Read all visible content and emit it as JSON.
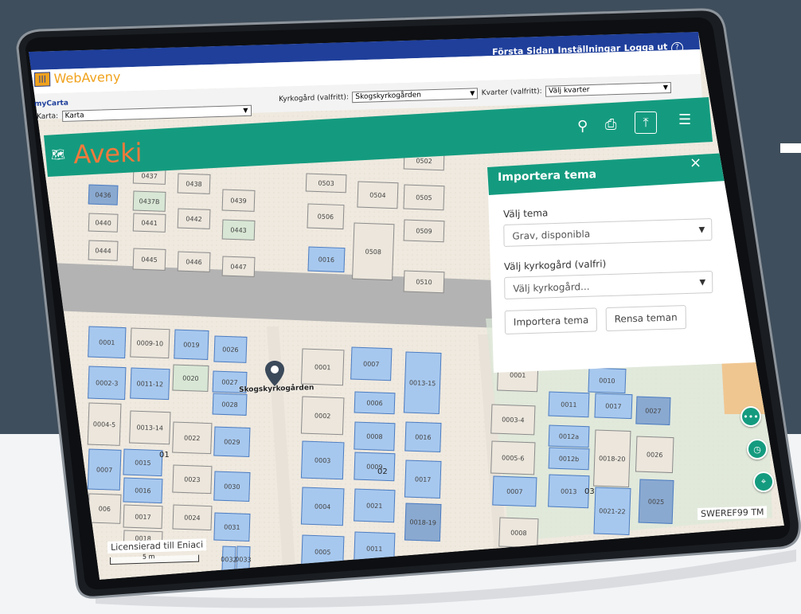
{
  "app": {
    "logo_text": "WebAveny",
    "nav": [
      "Första Sidan",
      "Inställningar",
      "Logga ut"
    ],
    "help_icon": "help-circle-icon"
  },
  "selectors": {
    "mycarta_label": "myCarta",
    "karta_label": "Karta:",
    "karta_value": "Karta",
    "kyrkogard_label": "Kyrkogård (valfritt):",
    "kyrkogard_value": "Skogskyrkogården",
    "kvarter_label": "Kvarter (valfritt):",
    "kvarter_value": "Välj kvarter"
  },
  "toolbar": {
    "brand": "Aveki",
    "brand_color": "#f07a3c",
    "bar_color": "#149b7f",
    "icons": [
      "map-icon",
      "search-icon",
      "print-icon",
      "import-icon",
      "menu-icon"
    ]
  },
  "panel": {
    "title": "Importera tema",
    "tema_label": "Välj tema",
    "tema_value": "Grav, disponibla",
    "kyrkogard_label": "Välj kyrkogård (valfri)",
    "kyrkogard_placeholder": "Välj kyrkogård...",
    "import_button": "Importera tema",
    "clear_button": "Rensa teman"
  },
  "map": {
    "marker_label": "Skogskyrkogården",
    "crs": "SWEREF99 TM",
    "license": "Licensierad till Eniaci",
    "scale": "5 m",
    "section_labels": [
      "01",
      "02",
      "03"
    ],
    "plots_top_left": [
      "0436",
      "0437B",
      "0438",
      "0439",
      "0440",
      "0441",
      "0442",
      "0443",
      "0444",
      "0445",
      "0446",
      "0447"
    ],
    "plots_top_mid": [
      "0503",
      "0504",
      "0505",
      "0506",
      "0508",
      "0509",
      "0016",
      "0510",
      "0502",
      "0437"
    ],
    "plots_left": [
      "0001",
      "0009-10",
      "0019",
      "0026",
      "0002-3",
      "0011-12",
      "0020",
      "0027",
      "0028",
      "0013-14",
      "0022",
      "0029",
      "0015",
      "0023",
      "0030",
      "0016",
      "0017",
      "0024",
      "0031",
      "0018",
      "0032",
      "0033",
      "0004-5",
      "0007",
      "006"
    ],
    "plots_mid": [
      "0001",
      "0007",
      "0013-15",
      "0006",
      "0002",
      "0008",
      "0016",
      "0003",
      "0009",
      "0017",
      "0004",
      "0021",
      "0018-19",
      "0005",
      "0011"
    ],
    "plots_right": [
      "0001",
      "0010",
      "0011",
      "0017",
      "0027",
      "0003-4",
      "0012a",
      "0012b",
      "0018-20",
      "0026",
      "0005-6",
      "0007",
      "0013",
      "0021-22",
      "0025",
      "0008"
    ]
  },
  "fab_icons": [
    "more-icon",
    "clock-icon",
    "location-icon"
  ]
}
